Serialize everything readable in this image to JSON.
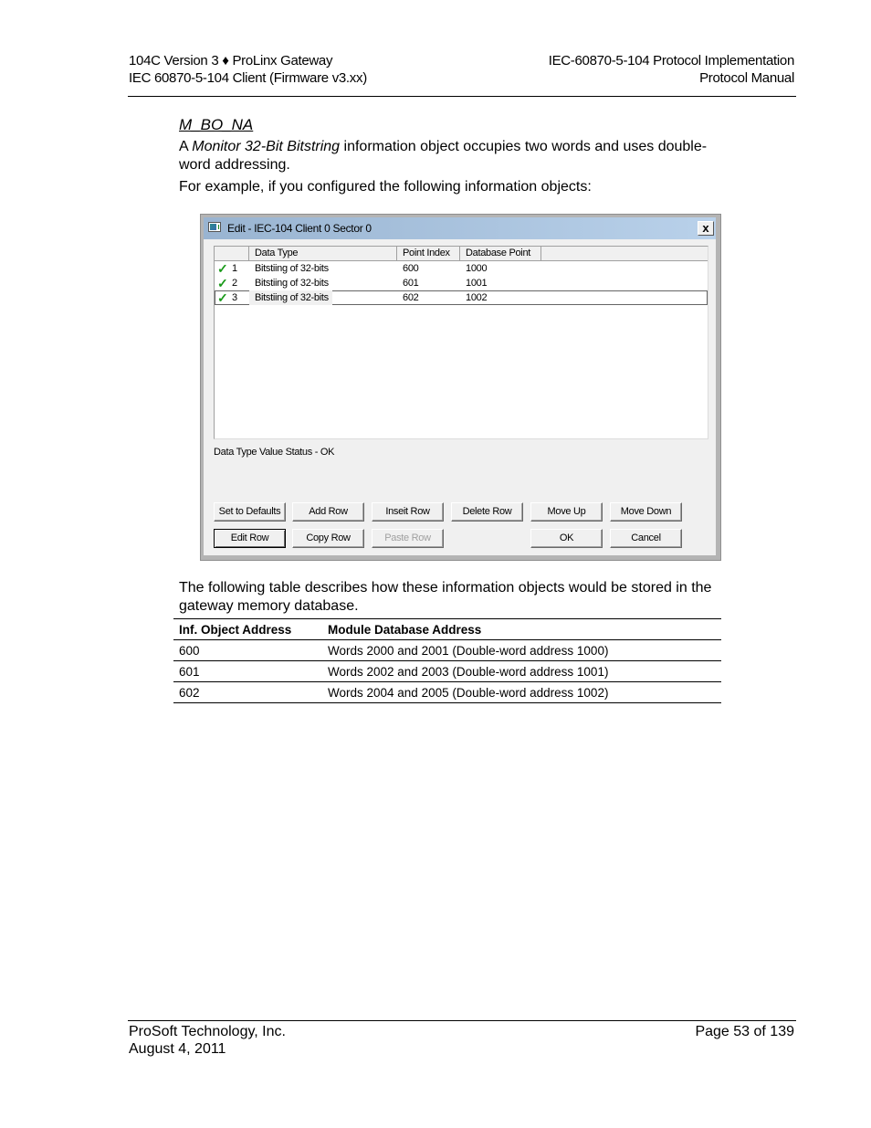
{
  "header": {
    "left_line1": "104C Version 3 ♦ ProLinx Gateway",
    "left_line2": "IEC 60870-5-104 Client (Firmware v3.xx)",
    "right_line1": "IEC-60870-5-104 Protocol Implementation",
    "right_line2": "Protocol Manual"
  },
  "section": {
    "title": "M_BO_NA",
    "para1_prefix": "A ",
    "para1_italic": "Monitor 32-Bit Bitstring",
    "para1_suffix": " information object occupies two words and uses double-word addressing.",
    "para2": "For example, if you configured the following information objects:",
    "para3": "The following table describes how these information objects would be stored in the gateway memory database."
  },
  "dialog": {
    "title": "Edit - IEC-104 Client 0 Sector 0",
    "close_label": "x",
    "columns": [
      "",
      "Data Type",
      "Point Index",
      "Database Point"
    ],
    "rows": [
      {
        "num": "1",
        "checked": true,
        "data_type": "Bitstiing of 32-bits",
        "point_index": "600",
        "database_point": "1000"
      },
      {
        "num": "2",
        "checked": true,
        "data_type": "Bitstiing of 32-bits",
        "point_index": "601",
        "database_point": "1001"
      },
      {
        "num": "3",
        "checked": true,
        "data_type": "Bitstiing of 32-bits",
        "point_index": "602",
        "database_point": "1002",
        "selected": true
      }
    ],
    "status": "Data Type Value Status - OK",
    "buttons": {
      "set_defaults": "Set to Defaults",
      "add_row": "Add Row",
      "insert_row": "Inseit Row",
      "delete_row": "Delete Row",
      "move_up": "Move Up",
      "move_down": "Move Down",
      "edit_row": "Edit Row",
      "copy_row": "Copy Row",
      "paste_row": "Paste Row",
      "ok": "OK",
      "cancel": "Cancel"
    }
  },
  "table": {
    "headers": [
      "Inf. Object Address",
      "Module Database Address"
    ],
    "rows": [
      [
        "600",
        "Words 2000 and 2001 (Double-word address 1000)"
      ],
      [
        "601",
        "Words 2002 and 2003 (Double-word address 1001)"
      ],
      [
        "602",
        "Words 2004 and 2005 (Double-word address 1002)"
      ]
    ]
  },
  "footer": {
    "company": "ProSoft Technology, Inc.",
    "date": "August 4, 2011",
    "page": "Page 53 of 139"
  },
  "colors": {
    "check_green": "#1a9a1a",
    "titlebar_start": "#99b4d1",
    "titlebar_end": "#b9d1ea",
    "dialog_bg": "#f0f0f0"
  }
}
